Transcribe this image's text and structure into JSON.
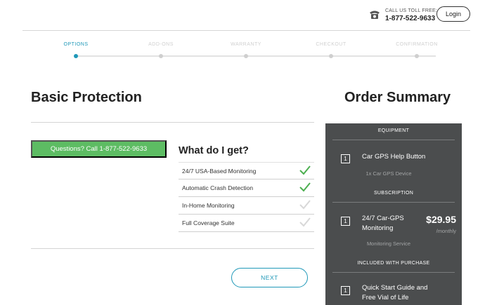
{
  "header": {
    "call_label": "CALL US TOLL FREE:",
    "call_number": "1-877-522-9633",
    "login_label": "Login"
  },
  "steps": [
    {
      "label": "OPTIONS",
      "active": true
    },
    {
      "label": "ADD-ONS",
      "active": false
    },
    {
      "label": "WARRANTY",
      "active": false
    },
    {
      "label": "CHECKOUT",
      "active": false
    },
    {
      "label": "CONFIRMATION",
      "active": false
    }
  ],
  "main": {
    "title": "Basic Protection",
    "questions_button": "Questions? Call 1-877-522-9633",
    "what_do_i_get": "What do I get?",
    "features": [
      {
        "label": "24/7 USA-Based Monitoring",
        "included": true
      },
      {
        "label": "Automatic Crash Detection",
        "included": true
      },
      {
        "label": "In-Home Monitoring",
        "included": false
      },
      {
        "label": "Full Coverage Suite",
        "included": false
      }
    ],
    "next_button": "NEXT"
  },
  "summary": {
    "title": "Order Summary",
    "equipment_heading": "EQUIPMENT",
    "equipment_item": {
      "qty": "1",
      "name": "Car GPS Help Button",
      "sub": "1x Car GPS Device"
    },
    "subscription_heading": "SUBSCRIPTION",
    "subscription_item": {
      "qty": "1",
      "name_line1": "24/7 Car-GPS",
      "name_line2": "Monitoring",
      "price": "$29.95",
      "period": "/monthly",
      "sub": "Monitoring Service"
    },
    "included_heading": "INCLUDED WITH PURCHASE",
    "included_item": {
      "qty": "1",
      "name_line1": "Quick Start Guide and",
      "name_line2": "Free Vial of Life"
    }
  },
  "colors": {
    "accent": "#1f98b8",
    "green": "#5dbc63",
    "panel": "#4b4d4e",
    "check_on": "#4caf50",
    "check_off": "#d8d8d8"
  },
  "icons": {
    "phone": "phone-icon",
    "check": "check-icon"
  }
}
